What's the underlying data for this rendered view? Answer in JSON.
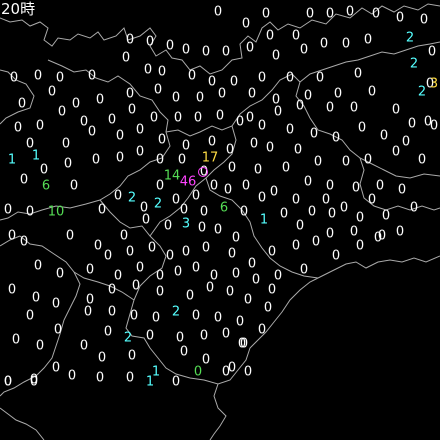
{
  "time_label": "20時",
  "colors": {
    "background": "#000000",
    "border": "#aaaaaa",
    "c0": "#ffffff",
    "c1": "#55ffff",
    "c2": "#55dd55",
    "c3": "#ffdd44",
    "c4": "#ff44ff"
  },
  "values": [
    {
      "t": "0",
      "c": 0
    },
    {
      "t": "0",
      "c": 0
    },
    {
      "t": "0",
      "c": 0
    },
    {
      "t": "0",
      "c": 0
    },
    {
      "t": "0",
      "c": 0
    },
    {
      "t": "0",
      "c": 0
    },
    {
      "t": "0",
      "c": 0
    },
    {
      "t": "0",
      "c": 0
    },
    {
      "t": "0",
      "c": 0
    },
    {
      "t": "0",
      "c": 0
    },
    {
      "t": "0",
      "c": 0
    },
    {
      "t": "0",
      "c": 0
    },
    {
      "t": "0",
      "c": 0
    },
    {
      "t": "2",
      "c": 1
    },
    {
      "t": "0",
      "c": 0
    },
    {
      "t": "0",
      "c": 0
    },
    {
      "t": "0",
      "c": 0
    },
    {
      "t": "0",
      "c": 0
    },
    {
      "t": "0",
      "c": 0
    },
    {
      "t": "0",
      "c": 0
    },
    {
      "t": "0",
      "c": 0
    },
    {
      "t": "0",
      "c": 0
    },
    {
      "t": "0",
      "c": 0
    },
    {
      "t": "0",
      "c": 0
    },
    {
      "t": "0",
      "c": 0
    },
    {
      "t": "2",
      "c": 1
    },
    {
      "t": "0",
      "c": 0
    },
    {
      "t": "0",
      "c": 0
    },
    {
      "t": "0",
      "c": 0
    },
    {
      "t": "0",
      "c": 0
    },
    {
      "t": "0",
      "c": 0
    },
    {
      "t": "0",
      "c": 0
    },
    {
      "t": "0",
      "c": 0
    },
    {
      "t": "0",
      "c": 0
    },
    {
      "t": "0",
      "c": 0
    },
    {
      "t": "0",
      "c": 0
    },
    {
      "t": "0",
      "c": 0
    },
    {
      "t": "0",
      "c": 0
    },
    {
      "t": "0",
      "c": 0
    },
    {
      "t": "0",
      "c": 0
    },
    {
      "t": "0",
      "c": 0
    },
    {
      "t": "0",
      "c": 0
    },
    {
      "t": "0",
      "c": 0
    },
    {
      "t": "0",
      "c": 0
    },
    {
      "t": "0",
      "c": 0
    },
    {
      "t": "0",
      "c": 0
    },
    {
      "t": "0",
      "c": 0
    },
    {
      "t": "0",
      "c": 0
    },
    {
      "t": "0",
      "c": 0
    },
    {
      "t": "0",
      "c": 0
    },
    {
      "t": "0",
      "c": 0
    },
    {
      "t": "0",
      "c": 0
    },
    {
      "t": "0",
      "c": 0
    },
    {
      "t": "0",
      "c": 0
    },
    {
      "t": "0",
      "c": 0
    },
    {
      "t": "2",
      "c": 1
    },
    {
      "t": "3",
      "c": 3
    },
    {
      "t": "0",
      "c": 0
    },
    {
      "t": "0",
      "c": 0
    },
    {
      "t": "0",
      "c": 0
    },
    {
      "t": "0",
      "c": 0
    },
    {
      "t": "0",
      "c": 0
    },
    {
      "t": "0",
      "c": 0
    },
    {
      "t": "0",
      "c": 0
    },
    {
      "t": "0",
      "c": 0
    },
    {
      "t": "0",
      "c": 0
    },
    {
      "t": "0",
      "c": 0
    },
    {
      "t": "0",
      "c": 0
    },
    {
      "t": "0",
      "c": 0
    },
    {
      "t": "0",
      "c": 0
    },
    {
      "t": "0",
      "c": 0
    },
    {
      "t": "0",
      "c": 0
    },
    {
      "t": "0",
      "c": 0
    },
    {
      "t": "0",
      "c": 0
    },
    {
      "t": "0",
      "c": 0
    },
    {
      "t": "0",
      "c": 0
    },
    {
      "t": "0",
      "c": 0
    },
    {
      "t": "0",
      "c": 0
    },
    {
      "t": "0",
      "c": 0
    },
    {
      "t": "0",
      "c": 0
    },
    {
      "t": "0",
      "c": 0
    },
    {
      "t": "0",
      "c": 0
    },
    {
      "t": "0",
      "c": 0
    },
    {
      "t": "0",
      "c": 0
    },
    {
      "t": "1",
      "c": 1
    },
    {
      "t": "0",
      "c": 0
    },
    {
      "t": "0",
      "c": 0
    },
    {
      "t": "0",
      "c": 0
    },
    {
      "t": "0",
      "c": 0
    },
    {
      "t": "0",
      "c": 0
    },
    {
      "t": "0",
      "c": 0
    },
    {
      "t": "0",
      "c": 0
    },
    {
      "t": "0",
      "c": 0
    },
    {
      "t": "0",
      "c": 0
    },
    {
      "t": "0",
      "c": 0
    },
    {
      "t": "0",
      "c": 0
    },
    {
      "t": "0",
      "c": 0
    },
    {
      "t": "0",
      "c": 0
    },
    {
      "t": "0",
      "c": 0
    },
    {
      "t": "0",
      "c": 0
    },
    {
      "t": "0",
      "c": 0
    },
    {
      "t": "0",
      "c": 0
    },
    {
      "t": "0",
      "c": 0
    },
    {
      "t": "0",
      "c": 0
    },
    {
      "t": "1",
      "c": 1
    },
    {
      "t": "6",
      "c": 2
    },
    {
      "t": "0",
      "c": 0
    },
    {
      "t": "0",
      "c": 0
    },
    {
      "t": "0",
      "c": 0
    },
    {
      "t": "0",
      "c": 0
    },
    {
      "t": "17",
      "c": 3
    },
    {
      "t": "0",
      "c": 0
    },
    {
      "t": "0",
      "c": 0
    },
    {
      "t": "0",
      "c": 0
    },
    {
      "t": "0",
      "c": 0
    },
    {
      "t": "0",
      "c": 0
    },
    {
      "t": "0",
      "c": 0
    },
    {
      "t": "0",
      "c": 0
    },
    {
      "t": "0",
      "c": 0
    },
    {
      "t": "0",
      "c": 0
    },
    {
      "t": "0",
      "c": 0
    },
    {
      "t": "46",
      "c": 4
    },
    {
      "t": "14",
      "c": 2
    },
    {
      "t": "0",
      "c": 0
    },
    {
      "t": "0",
      "c": 0
    },
    {
      "t": "0",
      "c": 0
    },
    {
      "t": "0",
      "c": 0
    },
    {
      "t": "0",
      "c": 0
    },
    {
      "t": "0",
      "c": 0
    },
    {
      "t": "0",
      "c": 0
    },
    {
      "t": "0",
      "c": 0
    },
    {
      "t": "10",
      "c": 2
    },
    {
      "t": "0",
      "c": 0
    },
    {
      "t": "2",
      "c": 1
    },
    {
      "t": "0",
      "c": 0
    },
    {
      "t": "2",
      "c": 1
    },
    {
      "t": "0",
      "c": 0
    },
    {
      "t": "0",
      "c": 0
    },
    {
      "t": "0",
      "c": 0
    },
    {
      "t": "0",
      "c": 0
    },
    {
      "t": "0",
      "c": 0
    },
    {
      "t": "0",
      "c": 0
    },
    {
      "t": "0",
      "c": 0
    },
    {
      "t": "0",
      "c": 0
    },
    {
      "t": "0",
      "c": 0
    },
    {
      "t": "0",
      "c": 0
    },
    {
      "t": "0",
      "c": 0
    },
    {
      "t": "0",
      "c": 0
    },
    {
      "t": "0",
      "c": 0
    },
    {
      "t": "0",
      "c": 0
    },
    {
      "t": "0",
      "c": 0
    },
    {
      "t": "0",
      "c": 0
    },
    {
      "t": "0",
      "c": 0
    },
    {
      "t": "6",
      "c": 2
    },
    {
      "t": "0",
      "c": 0
    },
    {
      "t": "1",
      "c": 1
    },
    {
      "t": "0",
      "c": 0
    },
    {
      "t": "0",
      "c": 0
    },
    {
      "t": "0",
      "c": 0
    },
    {
      "t": "0",
      "c": 0
    },
    {
      "t": "0",
      "c": 0
    },
    {
      "t": "0",
      "c": 0
    },
    {
      "t": "0",
      "c": 0
    },
    {
      "t": "0",
      "c": 0
    },
    {
      "t": "0",
      "c": 0
    },
    {
      "t": "0",
      "c": 0
    },
    {
      "t": "0",
      "c": 0
    },
    {
      "t": "3",
      "c": 1
    },
    {
      "t": "0",
      "c": 0
    },
    {
      "t": "0",
      "c": 0
    },
    {
      "t": "0",
      "c": 0
    },
    {
      "t": "0",
      "c": 0
    },
    {
      "t": "0",
      "c": 0
    },
    {
      "t": "0",
      "c": 0
    },
    {
      "t": "0",
      "c": 0
    },
    {
      "t": "0",
      "c": 0
    },
    {
      "t": "0",
      "c": 0
    },
    {
      "t": "0",
      "c": 0
    },
    {
      "t": "0",
      "c": 0
    },
    {
      "t": "0",
      "c": 0
    },
    {
      "t": "0",
      "c": 0
    },
    {
      "t": "0",
      "c": 0
    },
    {
      "t": "0",
      "c": 0
    },
    {
      "t": "0",
      "c": 0
    },
    {
      "t": "0",
      "c": 0
    },
    {
      "t": "0",
      "c": 0
    },
    {
      "t": "0",
      "c": 0
    },
    {
      "t": "0",
      "c": 0
    },
    {
      "t": "0",
      "c": 0
    },
    {
      "t": "0",
      "c": 0
    },
    {
      "t": "0",
      "c": 0
    },
    {
      "t": "0",
      "c": 0
    },
    {
      "t": "0",
      "c": 0
    },
    {
      "t": "0",
      "c": 0
    },
    {
      "t": "0",
      "c": 0
    },
    {
      "t": "0",
      "c": 0
    },
    {
      "t": "0",
      "c": 0
    },
    {
      "t": "0",
      "c": 0
    },
    {
      "t": "0",
      "c": 0
    },
    {
      "t": "0",
      "c": 0
    },
    {
      "t": "0",
      "c": 0
    },
    {
      "t": "0",
      "c": 0
    },
    {
      "t": "0",
      "c": 0
    },
    {
      "t": "0",
      "c": 0
    },
    {
      "t": "0",
      "c": 0
    },
    {
      "t": "0",
      "c": 0
    },
    {
      "t": "0",
      "c": 0
    },
    {
      "t": "0",
      "c": 0
    },
    {
      "t": "0",
      "c": 0
    },
    {
      "t": "0",
      "c": 0
    },
    {
      "t": "0",
      "c": 0
    },
    {
      "t": "0",
      "c": 0
    },
    {
      "t": "0",
      "c": 0
    },
    {
      "t": "0",
      "c": 0
    },
    {
      "t": "0",
      "c": 0
    },
    {
      "t": "0",
      "c": 0
    },
    {
      "t": "0",
      "c": 0
    },
    {
      "t": "0",
      "c": 0
    },
    {
      "t": "2",
      "c": 1
    },
    {
      "t": "0",
      "c": 0
    },
    {
      "t": "0",
      "c": 0
    },
    {
      "t": "0",
      "c": 0
    },
    {
      "t": "0",
      "c": 0
    },
    {
      "t": "0",
      "c": 0
    },
    {
      "t": "0",
      "c": 0
    },
    {
      "t": "0",
      "c": 0
    },
    {
      "t": "0",
      "c": 0
    },
    {
      "t": "2",
      "c": 1
    },
    {
      "t": "0",
      "c": 0
    },
    {
      "t": "0",
      "c": 0
    },
    {
      "t": "0",
      "c": 0
    },
    {
      "t": "0",
      "c": 0
    },
    {
      "t": "0",
      "c": 0
    },
    {
      "t": "0",
      "c": 0
    },
    {
      "t": "0",
      "c": 0
    },
    {
      "t": "0",
      "c": 0
    },
    {
      "t": "1",
      "c": 1
    },
    {
      "t": "0",
      "c": 0
    },
    {
      "t": "0",
      "c": 0
    },
    {
      "t": "0",
      "c": 0
    },
    {
      "t": "0",
      "c": 0
    },
    {
      "t": "0",
      "c": 0
    },
    {
      "t": "0",
      "c": 0
    },
    {
      "t": "0",
      "c": 0
    },
    {
      "t": "0",
      "c": 0
    },
    {
      "t": "0",
      "c": 0
    },
    {
      "t": "1",
      "c": 1
    },
    {
      "t": "0",
      "c": 0
    },
    {
      "t": "0",
      "c": 2
    },
    {
      "t": "0",
      "c": 0
    },
    {
      "t": "0",
      "c": 0
    },
    {
      "t": "0",
      "c": 0
    },
    {
      "t": "0",
      "c": 0
    }
  ]
}
